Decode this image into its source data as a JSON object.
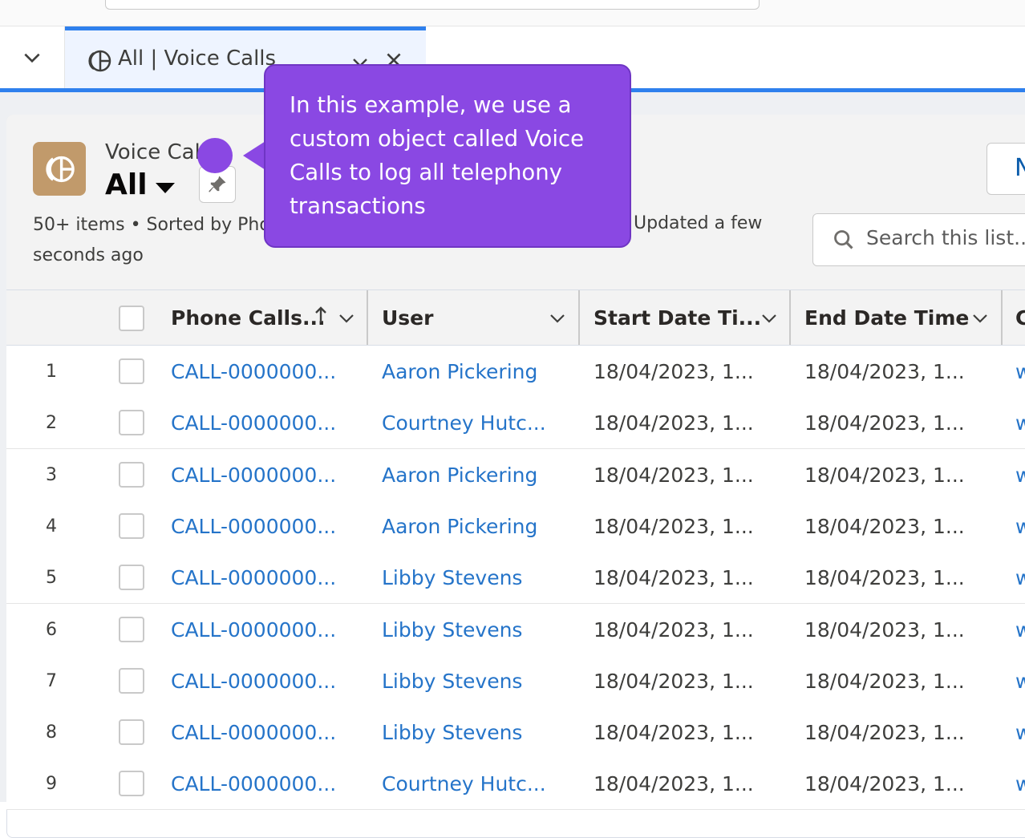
{
  "tab": {
    "label": "All | Voice Calls"
  },
  "header": {
    "object_name": "Voice Calls",
    "view_name": "All",
    "meta_left": "50+ items • Sorted by Phone Calls Name • Filtered by All voice calls",
    "meta_left_visible": "50+ items • Sorted by Pho",
    "meta_left_line2": "seconds ago",
    "meta_right": "Updated a few",
    "new_button_label": "N",
    "search_placeholder": "Search this list..."
  },
  "callout": {
    "text": "In this example, we use a custom object called Voice Calls to log all telephony transactions"
  },
  "table": {
    "columns": [
      "Phone Calls...",
      "User",
      "Start Date Ti...",
      "End Date Time",
      "C"
    ],
    "rows": [
      {
        "num": "1",
        "call": "CALL-0000000...",
        "user": "Aaron Pickering",
        "start": "18/04/2023, 1...",
        "end": "18/04/2023, 1...",
        "extra": "w"
      },
      {
        "num": "2",
        "call": "CALL-0000000...",
        "user": "Courtney Hutc...",
        "start": "18/04/2023, 1...",
        "end": "18/04/2023, 1...",
        "extra": "w"
      },
      {
        "num": "3",
        "call": "CALL-0000000...",
        "user": "Aaron Pickering",
        "start": "18/04/2023, 1...",
        "end": "18/04/2023, 1...",
        "extra": "w"
      },
      {
        "num": "4",
        "call": "CALL-0000000...",
        "user": "Aaron Pickering",
        "start": "18/04/2023, 1...",
        "end": "18/04/2023, 1...",
        "extra": "w"
      },
      {
        "num": "5",
        "call": "CALL-0000000...",
        "user": "Libby Stevens",
        "start": "18/04/2023, 1...",
        "end": "18/04/2023, 1...",
        "extra": "w"
      },
      {
        "num": "6",
        "call": "CALL-0000000...",
        "user": "Libby Stevens",
        "start": "18/04/2023, 1...",
        "end": "18/04/2023, 1...",
        "extra": "w"
      },
      {
        "num": "7",
        "call": "CALL-0000000...",
        "user": "Libby Stevens",
        "start": "18/04/2023, 1...",
        "end": "18/04/2023, 1...",
        "extra": "w"
      },
      {
        "num": "8",
        "call": "CALL-0000000...",
        "user": "Libby Stevens",
        "start": "18/04/2023, 1...",
        "end": "18/04/2023, 1...",
        "extra": "w"
      },
      {
        "num": "9",
        "call": "CALL-0000000...",
        "user": "Courtney Hutc...",
        "start": "18/04/2023, 1...",
        "end": "18/04/2023, 1...",
        "extra": "w"
      }
    ]
  },
  "colors": {
    "accent": "#2f80ed",
    "link": "#2574c9",
    "callout": "#8a48e3",
    "object_icon": "#c19a6b"
  },
  "icons": {
    "tab_object": "phone-call-icon",
    "pin": "pin-icon",
    "search": "search-icon",
    "chevron": "chevron-down-icon",
    "close": "close-icon"
  }
}
